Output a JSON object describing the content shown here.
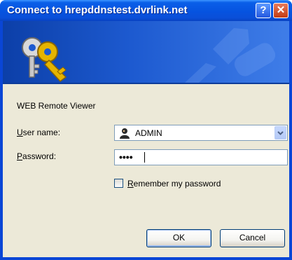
{
  "window": {
    "title": "Connect to hrepddnstest.dvrlink.net",
    "help_glyph": "?",
    "close_glyph": "✕"
  },
  "dialog": {
    "realm_text": "WEB Remote Viewer",
    "username": {
      "label_accel": "U",
      "label_rest": "ser name:",
      "value": "ADMIN"
    },
    "password": {
      "label_accel": "P",
      "label_rest": "assword:",
      "masked_value": "••••"
    },
    "remember": {
      "label_accel": "R",
      "label_rest": "emember my password",
      "checked": false
    },
    "ok_label": "OK",
    "cancel_label": "Cancel"
  },
  "icons": {
    "banner": "keys-icon",
    "user": "user-account-icon",
    "dropdown": "chevron-down-icon"
  },
  "colors": {
    "titlebar": "#0653e0",
    "banner": "#1d5ad0",
    "dialog_bg": "#ece9d8",
    "close": "#c33b12"
  }
}
